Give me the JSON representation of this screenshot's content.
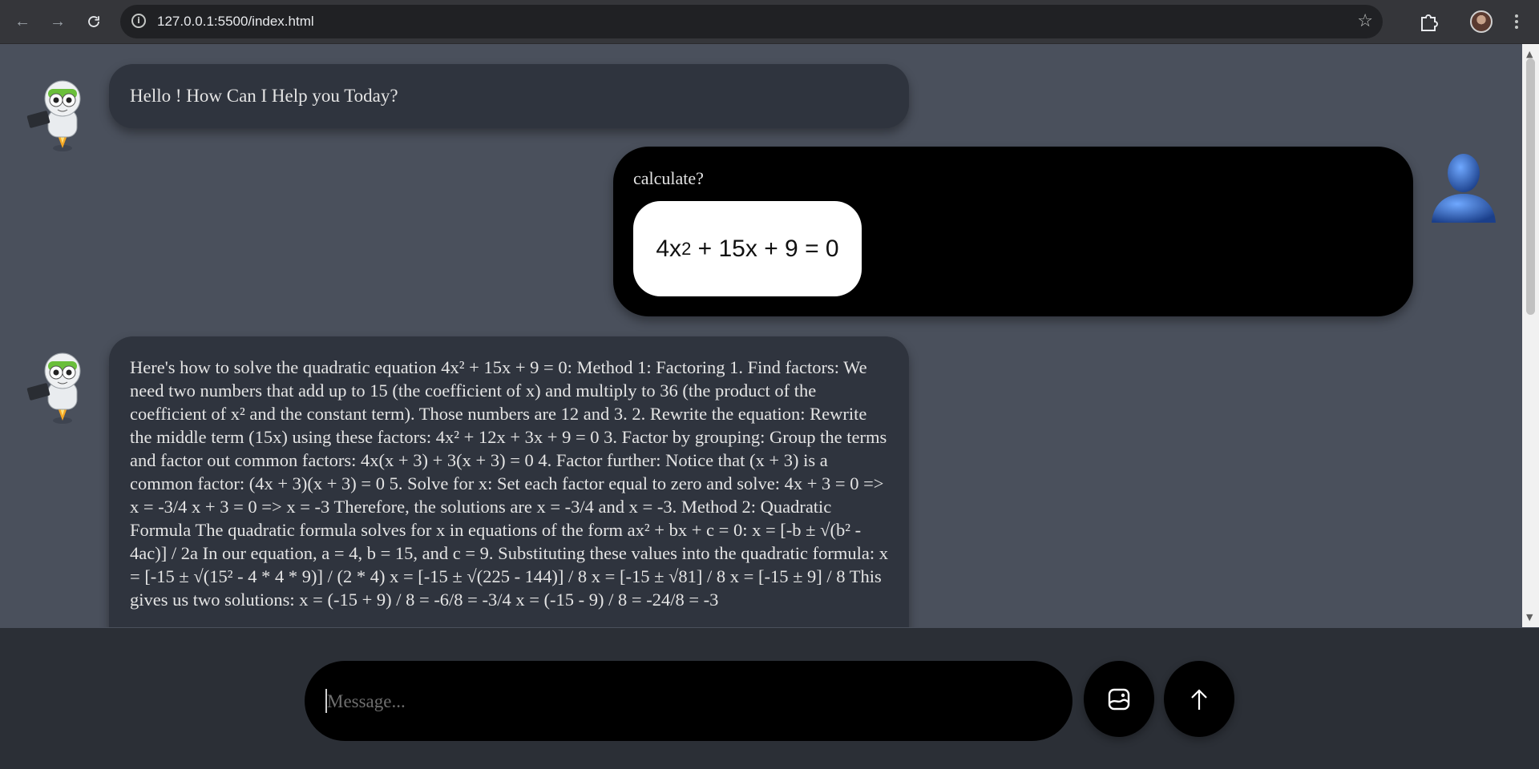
{
  "browser": {
    "url": "127.0.0.1:5500/index.html",
    "back_icon": "arrow-left-icon",
    "forward_icon": "arrow-right-icon",
    "reload_icon": "reload-icon",
    "info_icon": "info-icon",
    "bookmark_icon": "star-icon",
    "extensions_icon": "puzzle-icon",
    "menu_icon": "kebab-menu-icon"
  },
  "chat": {
    "greeting": "Hello ! How Can I Help you Today?",
    "user_message": {
      "text": "calculate?",
      "equation_parts": [
        "4x",
        "2",
        " + 15x + 9 = 0"
      ]
    },
    "bot_answer": "Here's how to solve the quadratic equation 4x² + 15x + 9 = 0: Method 1: Factoring 1. Find factors: We need two numbers that add up to 15 (the coefficient of x) and multiply to 36 (the product of the coefficient of x² and the constant term). Those numbers are 12 and 3. 2. Rewrite the equation: Rewrite the middle term (15x) using these factors: 4x² + 12x + 3x + 9 = 0 3. Factor by grouping: Group the terms and factor out common factors: 4x(x + 3) + 3(x + 3) = 0 4. Factor further: Notice that (x + 3) is a common factor: (4x + 3)(x + 3) = 0 5. Solve for x: Set each factor equal to zero and solve: 4x + 3 = 0 => x = -3/4 x + 3 = 0 => x = -3 Therefore, the solutions are x = -3/4 and x = -3. Method 2: Quadratic Formula The quadratic formula solves for x in equations of the form ax² + bx + c = 0: x = [-b ± √(b² - 4ac)] / 2a In our equation, a = 4, b = 15, and c = 9. Substituting these values into the quadratic formula: x = [-15 ± √(15² - 4 * 4 * 9)] / (2 * 4) x = [-15 ± √(225 - 144)] / 8 x = [-15 ± √81] / 8 x = [-15 ± 9] / 8 This gives us two solutions: x = (-15 + 9) / 8 = -6/8 = -3/4 x = (-15 - 9) / 8 = -24/8 = -3"
  },
  "composer": {
    "placeholder": "Message...",
    "image_button_icon": "image-upload-icon",
    "send_button_icon": "arrow-up-icon"
  }
}
